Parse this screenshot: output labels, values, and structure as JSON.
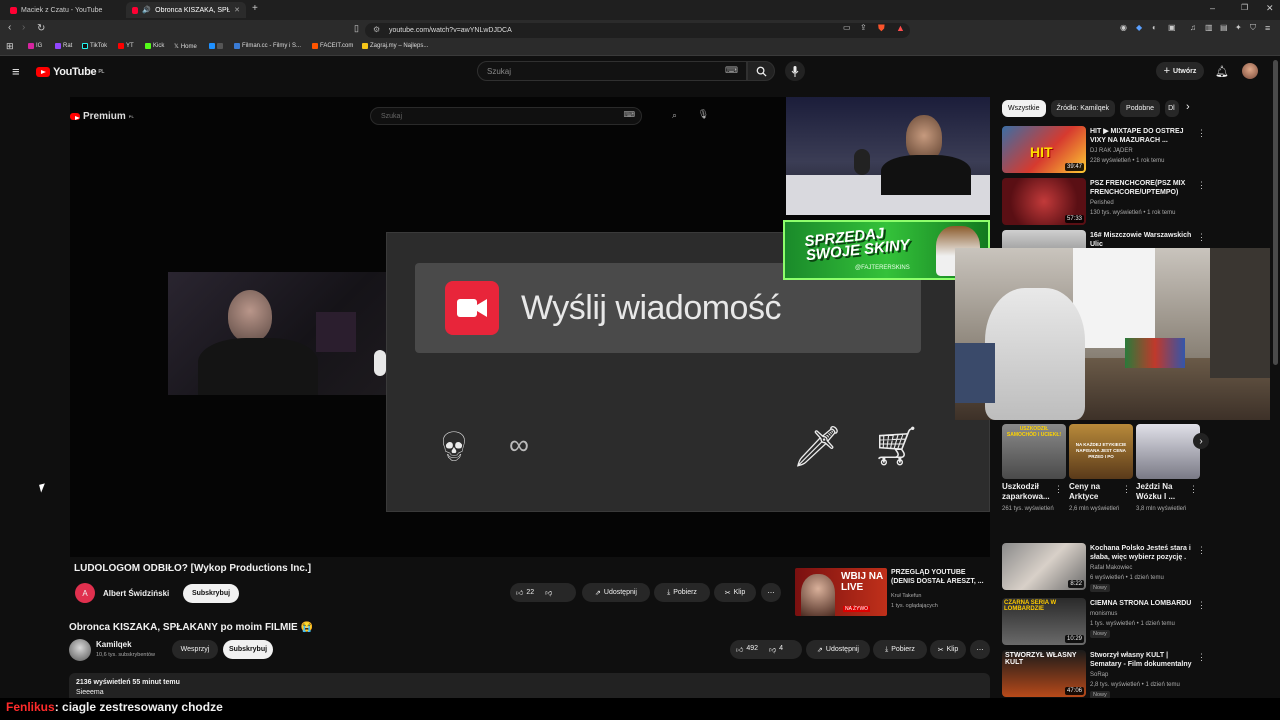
{
  "browser": {
    "tabs": [
      {
        "title": "Maciek z Czatu - YouTube",
        "active": false
      },
      {
        "title": "Obronca KISZAKA, SPŁAKAN",
        "active": true
      }
    ],
    "url": "youtube.com/watch?v=awYNLwDJDCA",
    "bookmarks": [
      "IG",
      "Rat",
      "TikTok",
      "YT",
      "Kick",
      "Home",
      "",
      "Filman.cc - Filmy i S...",
      "FACEIT.com",
      "Zagraj.my – Najleps..."
    ]
  },
  "header": {
    "logo": "YouTube",
    "region": "PL",
    "search_placeholder": "Szukaj",
    "create_label": "Utwórz"
  },
  "video": {
    "inner_logo": "Premium",
    "inner_region": "PL",
    "inner_search_placeholder": "Szukaj",
    "message_text": "Wyślij wiadomość",
    "infinity": "∞",
    "banner_text": "SPRZEDAJ SWOJE SKINY",
    "banner_handle": "@FAJTERERSKINS"
  },
  "inner_video": {
    "title": "LUDOLOGOM ODBIŁO? [Wykop Productions Inc.]",
    "channel": "Albert Świdziński",
    "subscribe": "Subskrybuj",
    "likes": "22",
    "share": "Udostępnij",
    "download": "Pobierz",
    "clip": "Klip",
    "rec_title": "PRZEGLĄD YOUTUBE (DENIS DOSTAŁ ARESZT, ...",
    "rec_channel": "Kruł Takefun",
    "rec_meta": "1 tys. oglądających",
    "rec_thumb_text": "WBIJ NA LIVE",
    "rec_thumb_sub": "NA ŻYWO"
  },
  "main_video": {
    "title": "Obronca KISZAKA, SPŁAKANY po moim FILMIE 😭",
    "channel": "Kamilqek",
    "subscribers": "10,6 tys. subskrybentów",
    "support": "Wesprzyj",
    "subscribe": "Subskrybuj",
    "likes": "492",
    "dislikes": "4",
    "share": "Udostępnij",
    "download": "Pobierz",
    "clip": "Klip",
    "views_time": "2136 wyświetleń  55 minut temu",
    "description": "Sieeema"
  },
  "sidebar": {
    "chips": [
      "Wszystkie",
      "Źródło: Kamilqek",
      "Podobne",
      "Dl"
    ],
    "recommended_top": [
      {
        "title": "HIT ▶ MIXTAPE DO OSTREJ VIXY NA MAZURACH ...",
        "channel": "DJ RAK JĄDER",
        "meta": "228 wyświetleń • 1 rok temu",
        "duration": "39:47",
        "thumb_text": "HIT"
      },
      {
        "title": "PSZ FRENCHCORE(PSZ MIX FRENCHCORE/UPTEMPO)",
        "channel": "Perished",
        "meta": "130 tys. wyświetleń • 1 rok temu",
        "duration": "57:33",
        "thumb_text": ""
      },
      {
        "title": "16# Miszczowie Warszawskich Ulic",
        "channel": "",
        "meta": "",
        "duration": "",
        "thumb_text": ""
      }
    ],
    "shorts": [
      {
        "title": "Uszkodził zaparkowa...",
        "views": "261 tys. wyświetleń",
        "thumb_text": "USZKODZIŁ SAMOCHÓD I UCIEKŁ!"
      },
      {
        "title": "Ceny na Arktyce",
        "views": "2,6 mln wyświetleń",
        "thumb_text": "NA KAŻDEJ ETYKIECIE NAPISANA JEST CENA PRZED I PO"
      },
      {
        "title": "Jeździ Na Wózku I ...",
        "views": "3,8 mln wyświetleń",
        "thumb_text": ""
      }
    ],
    "recommended_bottom": [
      {
        "title": "Kochana Polsko Jesteś stara i słaba, więc wybierz pozycję .",
        "channel": "Rafał Makowiec",
        "meta": "6 wyświetleń • 1 dzień temu",
        "badge": "Nowy",
        "duration": "8:22",
        "thumb_text": ""
      },
      {
        "title": "CIEMNA STRONA LOMBARDU",
        "channel": "monismus",
        "meta": "1 tys. wyświetleń • 1 dzień temu",
        "badge": "Nowy",
        "duration": "10:29",
        "thumb_text": "CZARNA SERIA W LOMBARDZIE"
      },
      {
        "title": "Stworzył własny KULT | Sematary - Film dokumentalny",
        "channel": "SoRap",
        "meta": "2,8 tys. wyświetleń • 1 dzień temu",
        "badge": "Nowy",
        "duration": "47:06",
        "thumb_text": "STWORZYŁ WŁASNY KULT"
      }
    ]
  },
  "chat": {
    "user": "Fenlikus",
    "message": ": ciagle zestresowany chodze",
    "user_color": "#ff2b2b"
  },
  "colors": {
    "accent": "#ff0000",
    "background": "#0f0f0f",
    "banner_green": "#34c23a"
  }
}
